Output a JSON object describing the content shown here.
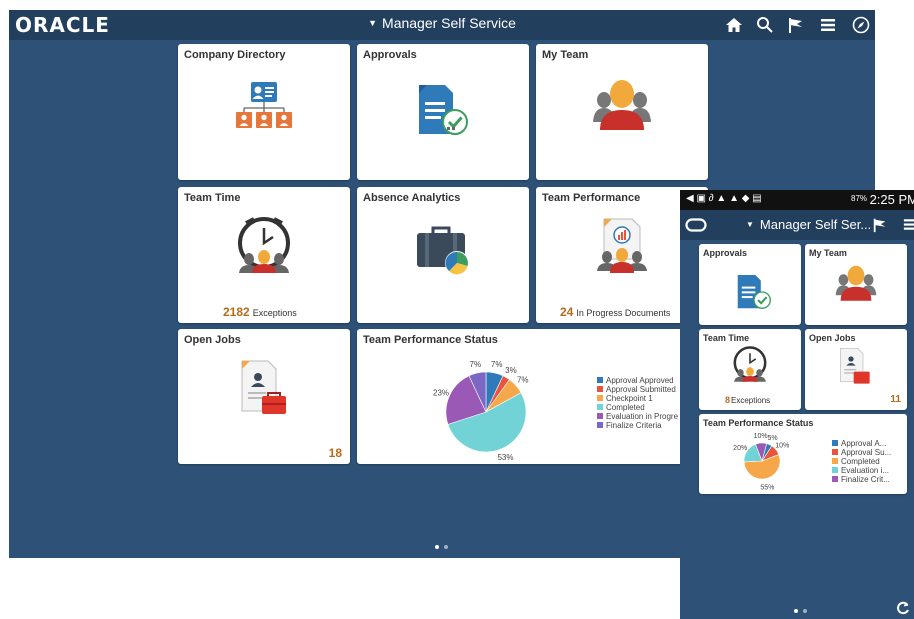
{
  "desktop": {
    "logo": "ORACLE",
    "title": "Manager Self Service",
    "nav_icons": [
      "home-icon",
      "search-icon",
      "flag-icon",
      "menu-icon",
      "compass-icon"
    ],
    "tiles": {
      "company_directory": {
        "title": "Company Directory"
      },
      "approvals": {
        "title": "Approvals"
      },
      "my_team": {
        "title": "My Team"
      },
      "team_time": {
        "title": "Team Time",
        "count": "2182",
        "count_label": "Exceptions"
      },
      "absence_analytics": {
        "title": "Absence Analytics"
      },
      "team_performance": {
        "title": "Team Performance",
        "count": "24",
        "count_label": "In Progress Documents"
      },
      "open_jobs": {
        "title": "Open Jobs",
        "count": "18"
      },
      "team_performance_status": {
        "title": "Team Performance Status"
      }
    },
    "page_dots": 2
  },
  "phone": {
    "status_bar": {
      "battery": "87%",
      "time": "2:25 PM"
    },
    "title": "Manager Self Ser...",
    "tiles": {
      "approvals": {
        "title": "Approvals"
      },
      "my_team": {
        "title": "My Team"
      },
      "team_time": {
        "title": "Team Time",
        "count": "8",
        "count_label": "Exceptions"
      },
      "open_jobs": {
        "title": "Open Jobs",
        "count": "11"
      },
      "team_performance_status": {
        "title": "Team Performance Status"
      }
    }
  },
  "colors": {
    "background": "#2e5277",
    "header": "#233f5e",
    "count": "#b86b1e",
    "series": [
      "#2f7ab9",
      "#e8553e",
      "#f5a74a",
      "#72d3d6",
      "#9b59b6",
      "#7b68c4"
    ]
  },
  "chart_data": [
    {
      "type": "pie",
      "title": "Team Performance Status",
      "categories": [
        "Approval Approved",
        "Approval Submitted",
        "Checkpoint 1",
        "Completed",
        "Evaluation in Progress",
        "Finalize Criteria"
      ],
      "legend_labels": [
        "Approval Approved",
        "Approval Submitted",
        "Checkpoint 1",
        "Completed",
        "Evaluation in Progre",
        "Finalize Criteria"
      ],
      "values": [
        7,
        3,
        7,
        53,
        23,
        7
      ],
      "labels": [
        "7%",
        "3%",
        "7%",
        "53%",
        "23%",
        "7%"
      ],
      "colors": [
        "#2f7ab9",
        "#e8553e",
        "#f5a74a",
        "#72d3d6",
        "#9b59b6",
        "#7b68c4"
      ],
      "legend_position": "right"
    },
    {
      "type": "pie",
      "title": "Team Performance Status",
      "categories": [
        "Approval A...",
        "Approval Su...",
        "Completed",
        "Evaluation i...",
        "Finalize Crit..."
      ],
      "values": [
        5,
        10,
        55,
        20,
        10
      ],
      "labels": [
        "5%",
        "10%",
        "55%",
        "20%",
        "10%"
      ],
      "colors": [
        "#2f7ab9",
        "#e8553e",
        "#f5a74a",
        "#72d3d6",
        "#9b59b6"
      ],
      "legend_position": "right"
    }
  ]
}
